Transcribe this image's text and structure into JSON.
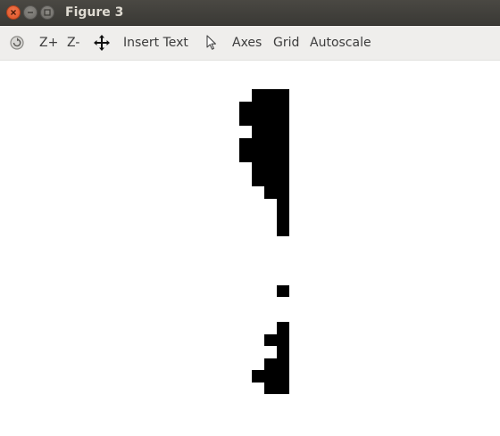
{
  "window": {
    "title": "Figure 3"
  },
  "toolbar": {
    "reset_icon": "reset-view-icon",
    "zoom_in_label": "Z+",
    "zoom_out_label": "Z-",
    "pan_icon": "move-arrows-icon",
    "insert_text_label": "Insert Text",
    "select_icon": "cursor-pointer-icon",
    "axes_label": "Axes",
    "grid_label": "Grid",
    "autoscale_label": "Autoscale"
  },
  "colors": {
    "titlebar": "#3c3b37",
    "toolbar": "#efeeec",
    "close_button": "#e95420",
    "pixel": "#000000",
    "canvas": "#ffffff"
  }
}
